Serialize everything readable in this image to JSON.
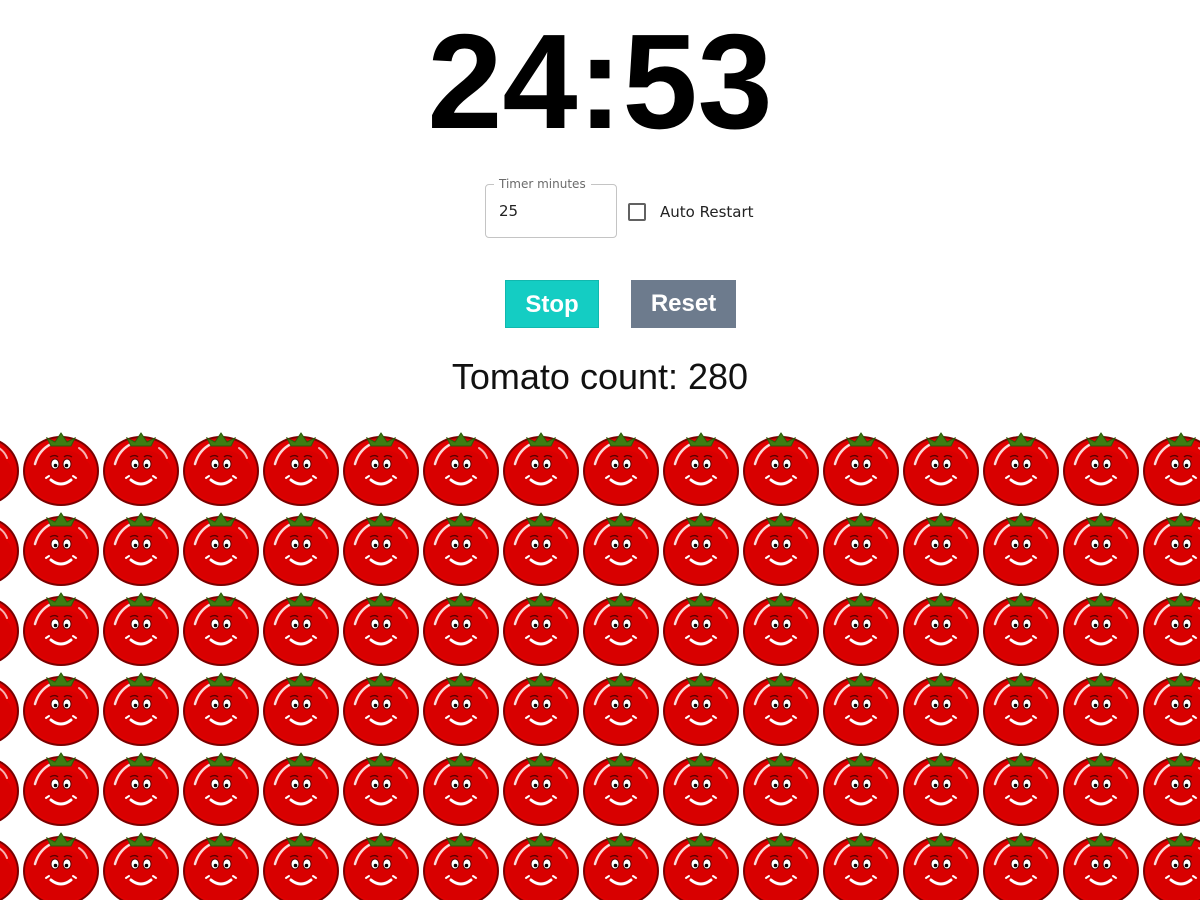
{
  "timer": {
    "display": "24:53"
  },
  "settings": {
    "minutes_label": "Timer minutes",
    "minutes_value": "25",
    "auto_restart_label": "Auto Restart",
    "auto_restart_checked": false
  },
  "controls": {
    "stop_label": "Stop",
    "reset_label": "Reset"
  },
  "counter": {
    "label": "Tomato count: 280",
    "value": 280
  },
  "tomato_icon": "smiling-tomato-icon",
  "colors": {
    "stop_button": "#14cdc3",
    "reset_button": "#6d7b8d",
    "tomato_red": "#e00000"
  }
}
